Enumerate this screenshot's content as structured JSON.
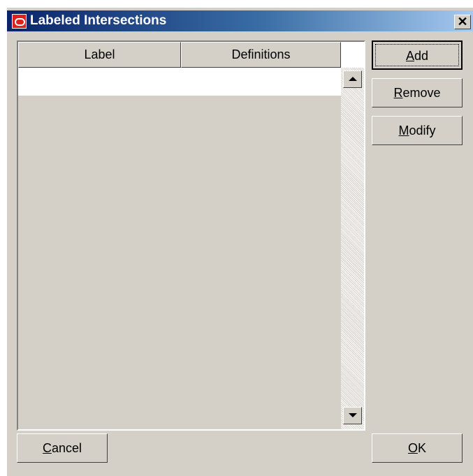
{
  "window": {
    "title": "Labeled Intersections"
  },
  "icons": {
    "app": "oracle-logo-icon",
    "close": "close-icon",
    "scroll_up": "arrow-up-icon",
    "scroll_down": "arrow-down-icon"
  },
  "table": {
    "columns": [
      "Label",
      "Definitions"
    ],
    "rows": []
  },
  "buttons": {
    "add": {
      "accel": "A",
      "rest": "dd"
    },
    "remove": {
      "accel": "R",
      "rest": "emove"
    },
    "modify": {
      "accel": "M",
      "rest": "odify"
    },
    "cancel": {
      "accel": "C",
      "rest": "ancel"
    },
    "ok": {
      "accel": "O",
      "rest": "K"
    }
  },
  "colors": {
    "face": "#d4d0c8",
    "title_start": "#0a246a",
    "title_end": "#a6caf0",
    "logo_red": "#e0201a"
  }
}
